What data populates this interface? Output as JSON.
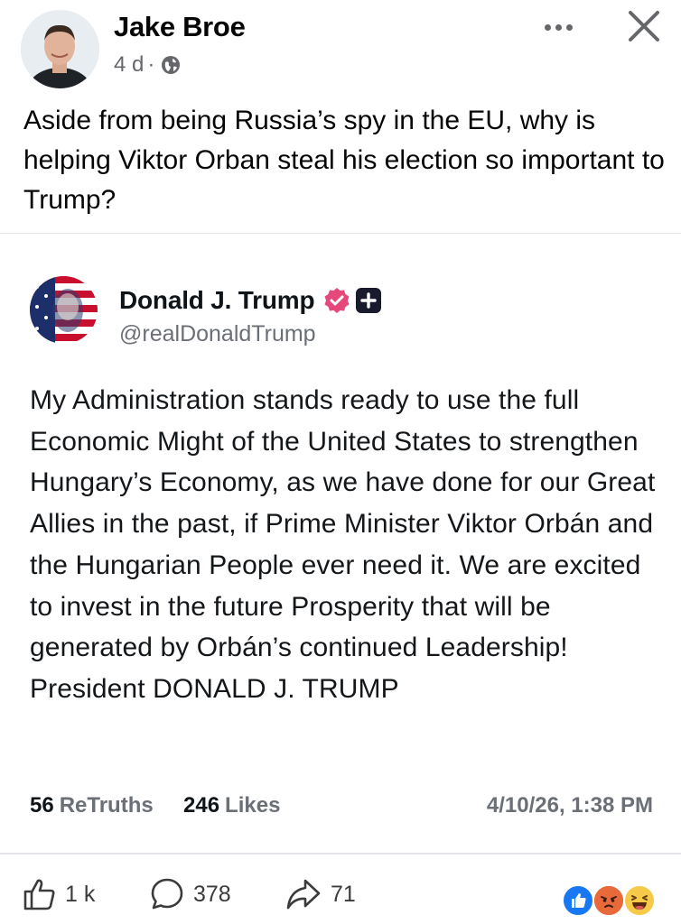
{
  "post": {
    "author": "Jake Broe",
    "time": "4 d",
    "separator": "·",
    "privacy_icon": "globe-icon",
    "text": "Aside from being Russia’s spy in the EU, why is helping Viktor Orban steal his election so important to Trump?"
  },
  "shared": {
    "name": "Donald J. Trump",
    "handle": "@realDonaldTrump",
    "verified_color": "#e5497b",
    "body": "My Administration stands ready to use the full Economic Might of the United States to strengthen Hungary’s Economy, as we have done for our Great Allies in the past, if Prime Minister Viktor Orbán and the Hungarian People ever need it. We are excited to invest in the future Prosperity that will be generated by Orbán’s continued Leadership! President DONALD J. TRUMP",
    "stats": {
      "retruths_count": "56",
      "retruths_label": "ReTruths",
      "likes_count": "246",
      "likes_label": "Likes",
      "date": "4/10/26, 1:38 PM"
    }
  },
  "actions": {
    "like_count": "1 k",
    "comment_count": "378",
    "share_count": "71"
  },
  "colors": {
    "like_blue": "#1877f2",
    "angry_red": "#e4574a",
    "haha_yellow": "#f7c948"
  }
}
